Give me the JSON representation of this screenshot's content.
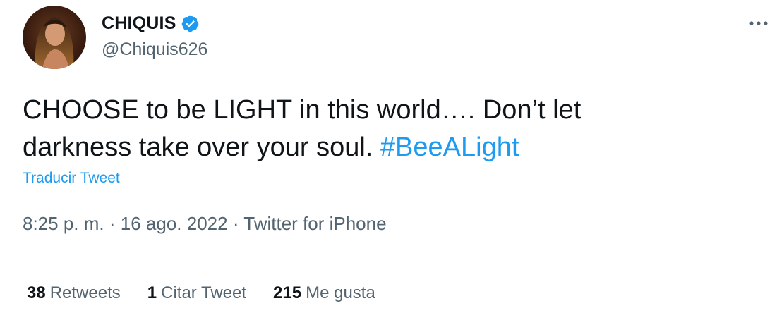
{
  "author": {
    "display_name": "CHIQUIS",
    "handle": "@Chiquis626",
    "verified": true
  },
  "tweet": {
    "text_line1": "CHOOSE to be LIGHT in this world…. Don’t let",
    "text_line2": "darkness take over your soul.",
    "hashtag": "#BeeALight",
    "translate_label": "Traducir Tweet",
    "time": "8:25 p. m.",
    "separator": "·",
    "date": "16 ago. 2022",
    "source": "Twitter for iPhone"
  },
  "stats": {
    "retweets_count": "38",
    "retweets_label": "Retweets",
    "quotes_count": "1",
    "quotes_label": "Citar Tweet",
    "likes_count": "215",
    "likes_label": "Me gusta"
  },
  "colors": {
    "accent": "#1d9bf0",
    "text_primary": "#0f1419",
    "text_secondary": "#536471",
    "divider": "#eff3f4"
  },
  "icons": {
    "verified": "verified-badge-icon",
    "more": "more-options-icon"
  }
}
